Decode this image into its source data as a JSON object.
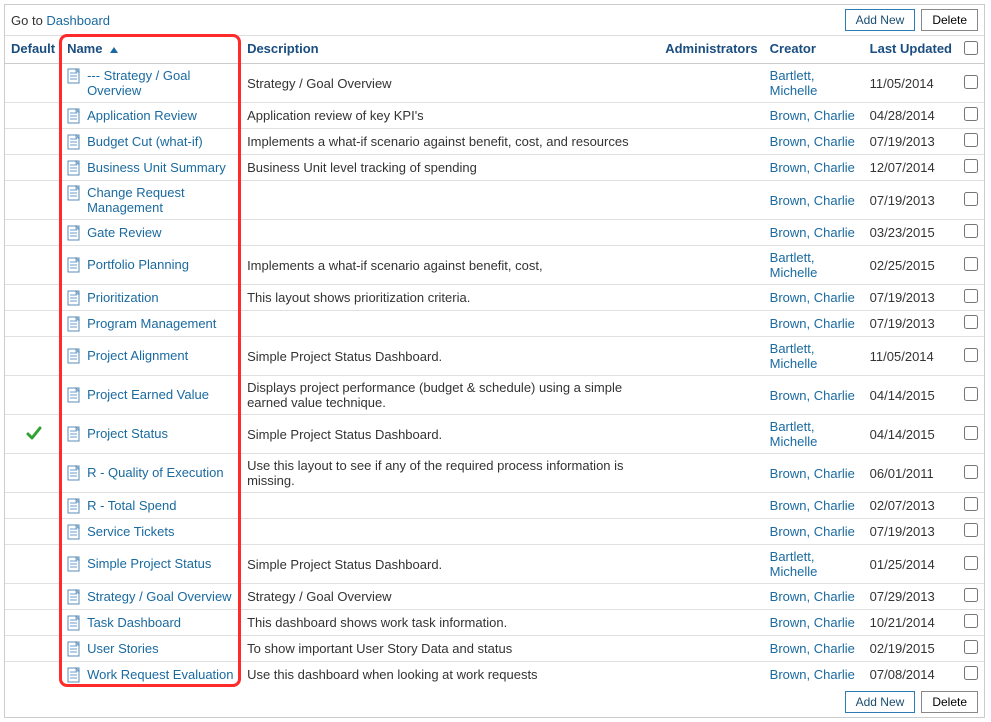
{
  "breadcrumb": {
    "prefix": "Go to ",
    "link": "Dashboard"
  },
  "buttons": {
    "add_new": "Add New",
    "delete": "Delete"
  },
  "headers": {
    "default": "Default",
    "name": "Name",
    "description": "Description",
    "administrators": "Administrators",
    "creator": "Creator",
    "last_updated": "Last Updated"
  },
  "sort": {
    "column": "name",
    "direction": "asc"
  },
  "rows": [
    {
      "default": false,
      "name": "--- Strategy / Goal Overview",
      "description": "Strategy / Goal Overview",
      "administrators": "",
      "creator": "Bartlett, Michelle",
      "last_updated": "11/05/2014"
    },
    {
      "default": false,
      "name": "Application Review",
      "description": "Application review of key KPI's",
      "administrators": "",
      "creator": "Brown, Charlie",
      "last_updated": "04/28/2014"
    },
    {
      "default": false,
      "name": "Budget Cut (what-if)",
      "description": "Implements a what-if scenario against benefit, cost, and resources",
      "administrators": "",
      "creator": "Brown, Charlie",
      "last_updated": "07/19/2013"
    },
    {
      "default": false,
      "name": "Business Unit Summary",
      "description": "Business Unit level tracking of spending",
      "administrators": "",
      "creator": "Brown, Charlie",
      "last_updated": "12/07/2014"
    },
    {
      "default": false,
      "name": "Change Request Management",
      "description": "",
      "administrators": "",
      "creator": "Brown, Charlie",
      "last_updated": "07/19/2013"
    },
    {
      "default": false,
      "name": "Gate Review",
      "description": "",
      "administrators": "",
      "creator": "Brown, Charlie",
      "last_updated": "03/23/2015"
    },
    {
      "default": false,
      "name": "Portfolio Planning",
      "description": "Implements a what-if scenario against benefit, cost,",
      "administrators": "",
      "creator": "Bartlett, Michelle",
      "last_updated": "02/25/2015"
    },
    {
      "default": false,
      "name": "Prioritization",
      "description": "This layout shows prioritization criteria.",
      "administrators": "",
      "creator": "Brown, Charlie",
      "last_updated": "07/19/2013"
    },
    {
      "default": false,
      "name": "Program Management",
      "description": "",
      "administrators": "",
      "creator": "Brown, Charlie",
      "last_updated": "07/19/2013"
    },
    {
      "default": false,
      "name": "Project Alignment",
      "description": "Simple Project Status Dashboard.",
      "administrators": "",
      "creator": "Bartlett, Michelle",
      "last_updated": "11/05/2014"
    },
    {
      "default": false,
      "name": "Project Earned Value",
      "description": "Displays project performance (budget & schedule) using a simple earned value technique.",
      "administrators": "",
      "creator": "Brown, Charlie",
      "last_updated": "04/14/2015"
    },
    {
      "default": true,
      "name": "Project Status",
      "description": "Simple Project Status Dashboard.",
      "administrators": "",
      "creator": "Bartlett, Michelle",
      "last_updated": "04/14/2015"
    },
    {
      "default": false,
      "name": "R - Quality of Execution",
      "description": "Use this layout to see if any of the required process information is missing.",
      "administrators": "",
      "creator": "Brown, Charlie",
      "last_updated": "06/01/2011"
    },
    {
      "default": false,
      "name": "R - Total Spend",
      "description": "",
      "administrators": "",
      "creator": "Brown, Charlie",
      "last_updated": "02/07/2013"
    },
    {
      "default": false,
      "name": "Service Tickets",
      "description": "",
      "administrators": "",
      "creator": "Brown, Charlie",
      "last_updated": "07/19/2013"
    },
    {
      "default": false,
      "name": "Simple Project Status",
      "description": "Simple Project Status Dashboard.",
      "administrators": "",
      "creator": "Bartlett, Michelle",
      "last_updated": "01/25/2014"
    },
    {
      "default": false,
      "name": "Strategy / Goal Overview",
      "description": "Strategy / Goal Overview",
      "administrators": "",
      "creator": "Brown, Charlie",
      "last_updated": "07/29/2013"
    },
    {
      "default": false,
      "name": "Task Dashboard",
      "description": "This dashboard shows work task information.",
      "administrators": "",
      "creator": "Brown, Charlie",
      "last_updated": "10/21/2014"
    },
    {
      "default": false,
      "name": "User Stories",
      "description": "To show important User Story Data and status",
      "administrators": "",
      "creator": "Brown, Charlie",
      "last_updated": "02/19/2015"
    },
    {
      "default": false,
      "name": "Work Request Evaluation",
      "description": "Use this dashboard when looking at work requests",
      "administrators": "",
      "creator": "Brown, Charlie",
      "last_updated": "07/08/2014"
    }
  ],
  "highlight": {
    "column": "name"
  }
}
